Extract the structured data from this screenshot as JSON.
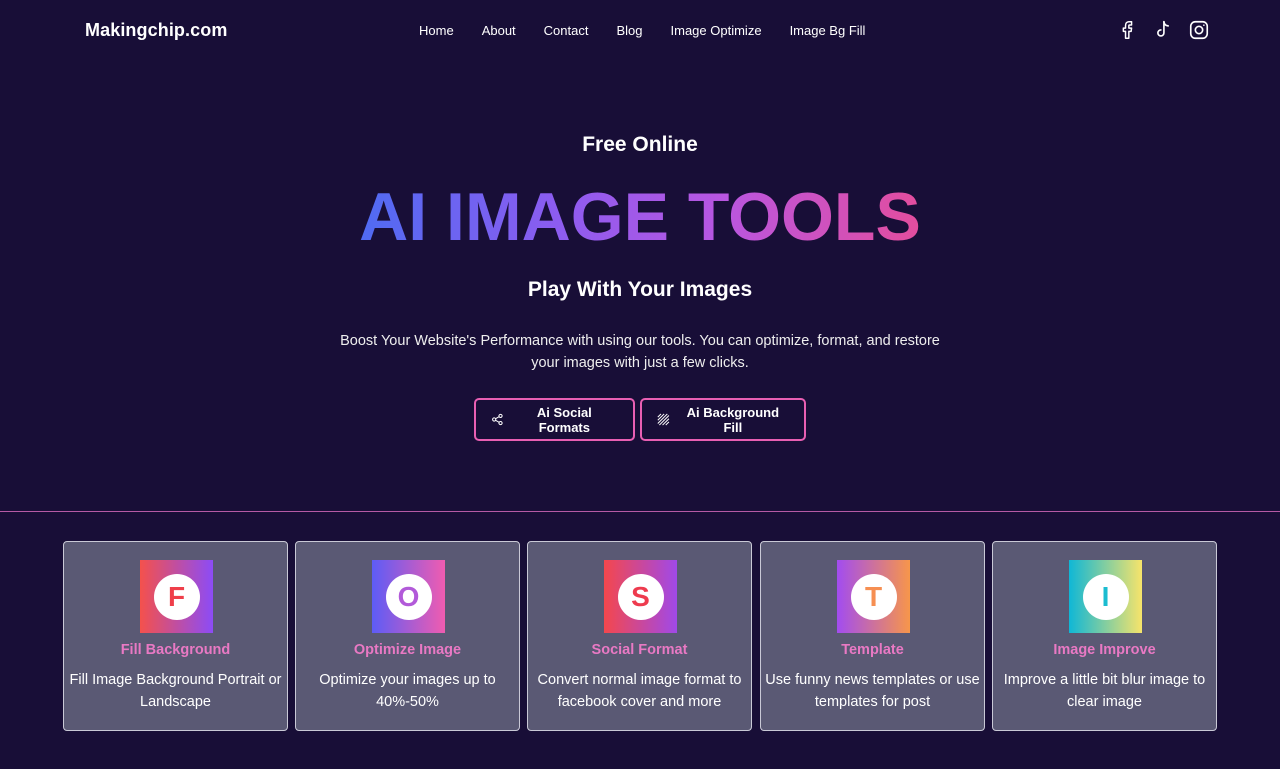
{
  "header": {
    "brand": "Makingchip.com",
    "nav": [
      "Home",
      "About",
      "Contact",
      "Blog",
      "Image Optimize",
      "Image Bg Fill"
    ],
    "socials": [
      "facebook-icon",
      "tiktok-icon",
      "instagram-icon"
    ]
  },
  "hero": {
    "pre_title": "Free Online",
    "title": "AI IMAGE TOOLS",
    "subtitle": "Play With Your Images",
    "description": "Boost Your Website's Performance with using our tools. You can optimize, format, and restore your images with just a few clicks.",
    "buttons": [
      {
        "label": "Ai Social Formats",
        "icon": "share-icon"
      },
      {
        "label": "Ai Background Fill",
        "icon": "pattern-icon"
      }
    ]
  },
  "cards": [
    {
      "letter": "F",
      "title": "Fill Background",
      "desc": "Fill Image Background Portrait or Landscape",
      "letter_color": "#ef3f4a"
    },
    {
      "letter": "O",
      "title": "Optimize Image",
      "desc": "Optimize your images up to 40%-50%",
      "letter_color": "#b25ad9"
    },
    {
      "letter": "S",
      "title": "Social Format",
      "desc": "Convert normal image format to facebook cover and more",
      "letter_color": "#ee3b4e"
    },
    {
      "letter": "T",
      "title": "Template",
      "desc": "Use funny news templates or use templates for post",
      "letter_color": "#f68f52"
    },
    {
      "letter": "I",
      "title": "Image Improve",
      "desc": "Improve a little bit blur image to clear image",
      "letter_color": "#1bbcd0"
    }
  ],
  "colors": {
    "background": "#180e37",
    "accent_pink": "#e85fb3",
    "card_bg": "#5a5974",
    "card_title": "#e979c4"
  }
}
